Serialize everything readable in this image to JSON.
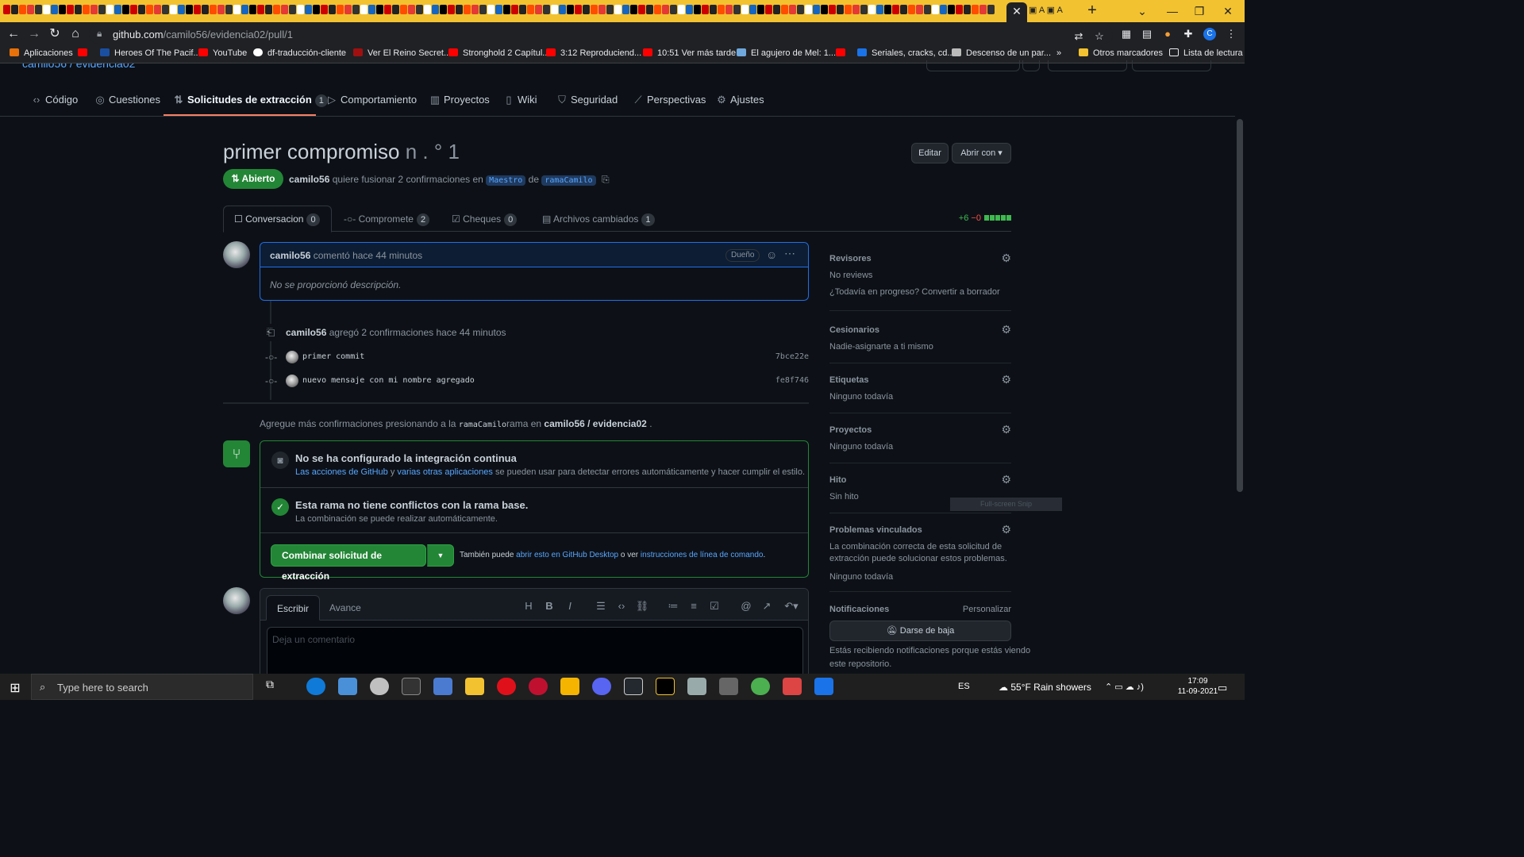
{
  "browser": {
    "url_host": "github.com",
    "url_path": "/camilo56/evidencia02/pull/1",
    "bookmarks": [
      "Aplicaciones",
      "Heroes Of The Pacif...",
      "YouTube",
      "df-traducción-cliente",
      "Ver El Reino Secret...",
      "Stronghold 2 Capítul...",
      "3:12 Reproduciend...",
      "10:51 Ver más tarde",
      "El agujero de Mel: 1...",
      "Seriales, cracks, cd...",
      "Descenso de un par...",
      "»",
      "Otros marcadores",
      "Lista de lectura"
    ],
    "profile_initial": "C"
  },
  "repo_nav": {
    "tabs": [
      {
        "label": "Código",
        "icon": "code-icon"
      },
      {
        "label": "Cuestiones",
        "icon": "issue-icon"
      },
      {
        "label": "Solicitudes de extracción",
        "icon": "pull-request-icon",
        "count": "1"
      },
      {
        "label": "Comportamiento",
        "icon": "play-icon"
      },
      {
        "label": "Proyectos",
        "icon": "project-icon"
      },
      {
        "label": "Wiki",
        "icon": "book-icon"
      },
      {
        "label": "Seguridad",
        "icon": "shield-icon"
      },
      {
        "label": "Perspectivas",
        "icon": "graph-icon"
      },
      {
        "label": "Ajustes",
        "icon": "gear-icon"
      }
    ]
  },
  "pr": {
    "title": "primer compromiso",
    "number": "n . ° 1",
    "edit_label": "Editar",
    "open_with_label": "Abrir con",
    "state": "Abierto",
    "author": "camilo56",
    "meta_text": "quiere fusionar 2 confirmaciones en",
    "base_branch": "Maestro",
    "from_text": "de",
    "head_branch": "ramaCamilo",
    "tabs": [
      {
        "label": "Conversacion",
        "count": "0"
      },
      {
        "label": "Comprometе",
        "count": "2"
      },
      {
        "label": "Cheques",
        "count": "0"
      },
      {
        "label": "Archivos cambiados",
        "count": "1"
      }
    ],
    "diff_add": "+6",
    "diff_del": "−0"
  },
  "comment": {
    "author": "camilo56",
    "action": "comentó hace 44 minutos",
    "badge": "Dueño",
    "body": "No se proporcionó descripción."
  },
  "commits_event": {
    "author": "camilo56",
    "text": "agregó 2 confirmaciones hace 44 minutos",
    "commits": [
      {
        "message": "primer commit",
        "sha": "7bce22e"
      },
      {
        "message": "nuevo mensaje con mi nombre agregado",
        "sha": "fe8f746"
      }
    ]
  },
  "push_hint": {
    "prefix": "Agregue más confirmaciones presionando a la",
    "branch": "ramaCamilo",
    "middle": "rama en",
    "repo": "camilo56 / evidencia02",
    "suffix": "."
  },
  "merge": {
    "ci_title": "No se ha configurado la integración continua",
    "ci_link1": "Las acciones de GitHub",
    "ci_and": "y",
    "ci_link2": "varias otras aplicaciones",
    "ci_rest": "se pueden usar para detectar errores automáticamente y hacer cumplir el estilo.",
    "noconflict_title": "Esta rama no tiene conflictos con la rama base.",
    "noconflict_sub": "La combinación se puede realizar automáticamente.",
    "merge_button": "Combinar solicitud de extracción",
    "alt_prefix": "También puede",
    "alt_link1": "abrir esto en GitHub Desktop",
    "alt_or": "o ver",
    "alt_link2": "instrucciones de línea de comando",
    "alt_suffix": "."
  },
  "new_comment": {
    "tab_write": "Escribir",
    "tab_preview": "Avance",
    "placeholder": "Deja un comentario"
  },
  "sidebar": {
    "reviewers_title": "Revisores",
    "reviewers_value": "No reviews",
    "reviewers_note": "¿Todavía en progreso? Convertir a borrador",
    "assignees_title": "Cesionarios",
    "assignees_value": "Nadie-asignarte a ti mismo",
    "labels_title": "Etiquetas",
    "labels_value": "Ninguno todavía",
    "projects_title": "Proyectos",
    "projects_value": "Ninguno todavía",
    "milestone_title": "Hito",
    "milestone_value": "Sin hito",
    "linked_title": "Problemas vinculados",
    "linked_desc1": "La combinación correcta de esta solicitud de",
    "linked_desc2": "extracción puede solucionar estos problemas.",
    "linked_value": "Ninguno todavía",
    "notif_title": "Notificaciones",
    "notif_customize": "Personalizar",
    "unsubscribe": "Darse de baja",
    "notif_note1": "Estás recibiendo notificaciones porque estás viendo",
    "notif_note2": "este repositorio.",
    "snip_tooltip": "Full-screen Snip"
  },
  "taskbar": {
    "search_placeholder": "Type here to search",
    "lang": "ES",
    "weather": "55°F  Rain showers",
    "time": "17:09",
    "date": "11-09-2021"
  },
  "colors": {
    "background": "#0d1117",
    "accent_green": "#238636",
    "link_blue": "#58a6ff",
    "tab_underline": "#f78166",
    "chrome_tabstrip": "#f2c230"
  }
}
